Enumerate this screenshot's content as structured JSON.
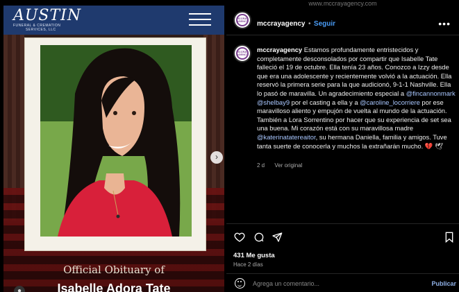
{
  "media": {
    "logo_main": "AUSTIN",
    "logo_sub": "FUNERAL & CREMATION",
    "logo_sub2": "SERVICES, LLC",
    "official_text": "Official Obituary of",
    "name_text": "Isabelle Adora Tate",
    "next_icon": "chevron-right-icon",
    "menu_icon": "hamburger-menu-icon"
  },
  "post": {
    "url": "www.mccrayagency.com",
    "handle": "mccrayagency",
    "avatar_text": "MCCRAY AGENCY",
    "separator": "•",
    "follow_label": "Seguir",
    "more_label": "•••",
    "caption": {
      "handle": "mccrayagency",
      "part1": " Estamos profundamente entristecidos y completamente desconsolados por compartir que Isabelle Tate falleció el 19 de octubre. Ella tenía 23 años. Conozco a Izzy desde que era una adolescente y recientemente volvió a la actuación. Ella reservó la primera serie para la que audicionó, 9-1-1 Nashville. Ella lo pasó de maravilla. Un agradecimiento especial a ",
      "mention1": "@fincannonmark",
      "mention2": "@shelbay9",
      "part2": " por el casting a ella y a ",
      "mention3": "@caroline_locorriere",
      "part3": " por ese maravilloso aliento y empujón de vuelta al mundo de la actuación. También a Lora Sorrentino por hacer que su experiencia de set sea una buena. Mi corazón está con su maravillosa madre ",
      "mention4": "@katerinatatereaitor",
      "part4": ", su hermana Daniella, familia y amigos. Tuve tanta suerte de conocerla y muchos la extrañarán mucho. 💔 🕊"
    },
    "time_ago": "2 d",
    "see_original": "Ver original",
    "likes": "431 Me gusta",
    "posted": "Hace 2 días",
    "comment_placeholder": "Agrega un comentario...",
    "publish_label": "Publicar",
    "colors": {
      "link": "#a9c7ff",
      "follow": "#4a9cf6",
      "logo_bar": "#1f3a6e"
    }
  }
}
